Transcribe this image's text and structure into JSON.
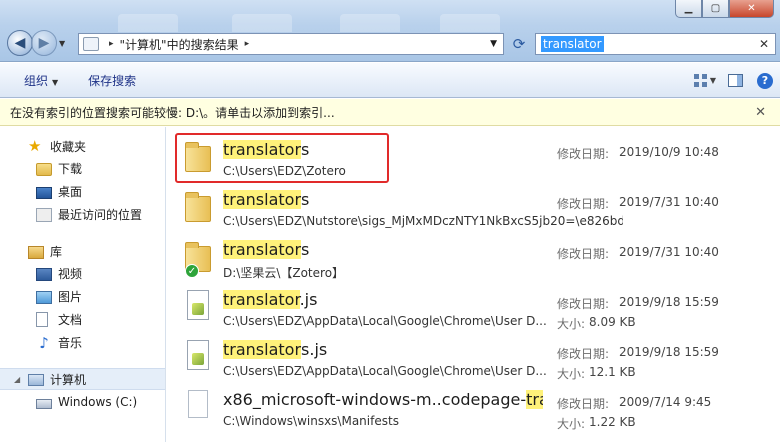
{
  "address": {
    "path_segment": "\"计算机\"中的搜索结果",
    "separator": "▸"
  },
  "search": {
    "query": "translator",
    "clear_glyph": "✕"
  },
  "window_controls": {
    "minimize": "▁",
    "maximize": "▢",
    "close": "✕"
  },
  "toolbar": {
    "organize_label": "组织",
    "save_search_label": "保存搜索",
    "dropdown_glyph": "▼"
  },
  "infobar": {
    "message": "在没有索引的位置搜索可能较慢: D:\\。请单击以添加到索引...",
    "close_glyph": "✕"
  },
  "sidebar": {
    "favorites": {
      "label": "收藏夹",
      "items": [
        {
          "label": "下载",
          "icon": "downloads-folder-icon"
        },
        {
          "label": "桌面",
          "icon": "desktop-icon"
        },
        {
          "label": "最近访问的位置",
          "icon": "recent-places-icon"
        }
      ]
    },
    "libraries": {
      "label": "库",
      "items": [
        {
          "label": "视频",
          "icon": "videos-icon"
        },
        {
          "label": "图片",
          "icon": "pictures-icon"
        },
        {
          "label": "文档",
          "icon": "documents-icon"
        },
        {
          "label": "音乐",
          "icon": "music-icon"
        }
      ]
    },
    "computer": {
      "label": "计算机",
      "items": [
        {
          "label": "Windows (C:)",
          "icon": "drive-icon"
        }
      ]
    }
  },
  "results": [
    {
      "name_hl": "translator",
      "name_rest": "s",
      "name_pre": "",
      "path": "C:\\Users\\EDZ\\Zotero",
      "date_label": "修改日期:",
      "date": "2019/10/9 10:48",
      "size_label": "",
      "size": "",
      "icon": "folder-icon"
    },
    {
      "name_hl": "translator",
      "name_rest": "s",
      "name_pre": "",
      "path": "C:\\Users\\EDZ\\Nutstore\\sigs_MjMxMDczNTY1NkBxcS5jb20=\\e826bd",
      "date_label": "修改日期:",
      "date": "2019/7/31 10:40",
      "size_label": "",
      "size": "",
      "icon": "folder-icon"
    },
    {
      "name_hl": "translator",
      "name_rest": "s",
      "name_pre": "",
      "path": "D:\\坚果云\\【Zotero】",
      "date_label": "修改日期:",
      "date": "2019/7/31 10:40",
      "size_label": "",
      "size": "",
      "icon": "synced-folder-icon"
    },
    {
      "name_hl": "translator",
      "name_rest": ".js",
      "name_pre": "",
      "path": "C:\\Users\\EDZ\\AppData\\Local\\Google\\Chrome\\User D...",
      "date_label": "修改日期:",
      "date": "2019/9/18 15:59",
      "size_label": "大小:",
      "size": "8.09 KB",
      "icon": "js-file-icon"
    },
    {
      "name_hl": "translator",
      "name_rest": "s.js",
      "name_pre": "",
      "path": "C:\\Users\\EDZ\\AppData\\Local\\Google\\Chrome\\User D...",
      "date_label": "修改日期:",
      "date": "2019/9/18 15:59",
      "size_label": "大小:",
      "size": "12.1 KB",
      "icon": "js-file-icon"
    },
    {
      "name_hl": "tra",
      "name_rest": "",
      "name_pre": "x86_microsoft-windows-m..codepage-",
      "path": "C:\\Windows\\winsxs\\Manifests",
      "date_label": "修改日期:",
      "date": "2009/7/14 9:45",
      "size_label": "大小:",
      "size": "1.22 KB",
      "icon": "manifest-file-icon"
    }
  ],
  "colors": {
    "highlight": "#fff27a",
    "annotation_box": "#e12a2a",
    "selection": "#3399ff"
  }
}
